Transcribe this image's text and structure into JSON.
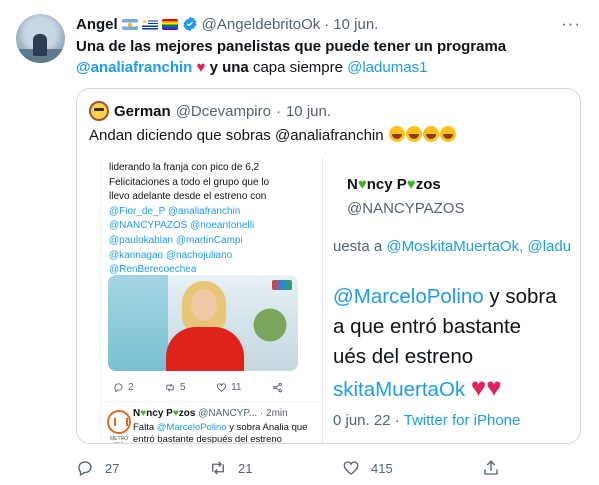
{
  "tweet": {
    "author_name": "Angel",
    "handle": "@AngeldebritoOk",
    "separator": "·",
    "time": "10 jun.",
    "more": "···",
    "body_line1": "Una de las mejores panelistas que puede tener un programa",
    "mention1": "@analiafranchin",
    "heart": "♥",
    "y": "y",
    "una": "una",
    "body_line2b": "capa siempre",
    "mention2": "@ladumas1"
  },
  "quote": {
    "author_name": "German",
    "handle": "@Dcevampiro",
    "separator": "·",
    "time": "10 jun.",
    "text": "Andan diciendo que sobras @analiafranchin"
  },
  "left_panel": {
    "line1": "liderando la franja con pico de 6,2",
    "line2": "Felicitaciones a todo el grupo que lo",
    "line3": "llevo adelante desde el estreno con",
    "m1": "@Fior_de_P",
    "m2": "@analiafranchin",
    "m3": "@NANCYPAZOS",
    "m4": "@noeantonelli",
    "m5": "@paulokablan",
    "m6": "@martinCampi",
    "m7": "@karinagao",
    "m8": "@nachojuliano",
    "m9": "@RenBerecoechea",
    "replies": "2",
    "retweets": "5",
    "likes": "11",
    "reply_name_a": "N",
    "reply_name_b": "ncy P",
    "reply_name_c": "zos",
    "reply_handle": "@NANCYP...",
    "reply_time": "· 2min",
    "reply_text_a": "Falta",
    "reply_text_mention": "@MarceloPolino",
    "reply_text_b": "y sobra Analia que entró bastante después del estreno",
    "station_label": "METRO 95.1"
  },
  "right_panel": {
    "name_a": "N",
    "name_b": "ncy P",
    "name_c": "zos",
    "handle": "@NANCYPAZOS",
    "reply_prefix": "uesta a",
    "reply_m1": "@MoskitaMuertaOk",
    "reply_sep": ",",
    "reply_m2": "@ladu",
    "big_m1": "@MarceloPolino",
    "big_1b": "y sobra",
    "big_2": "a que entró bastante",
    "big_3": "ués del estreno",
    "big_m2": "skitaMuertaOk",
    "big_hearts": "♥♥",
    "time": "0 jun. 22 ·",
    "source": "Twitter for iPhone"
  },
  "actions": {
    "replies": "27",
    "retweets": "21",
    "likes": "415"
  },
  "colors": {
    "accent": "#1d9bf0",
    "heart": "#e0245e",
    "muted": "#536471",
    "green_heart": "#43b02a"
  }
}
